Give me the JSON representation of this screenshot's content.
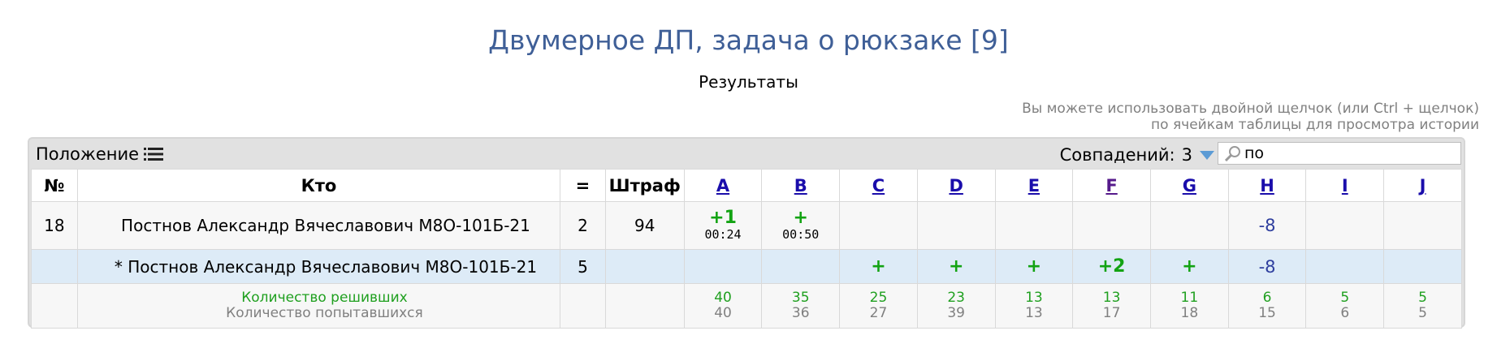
{
  "header": {
    "title": "Двумерное ДП, задача о рюкзаке [9]",
    "subtitle": "Результаты",
    "hint_line1": "Вы можете использовать двойной щелчок (или Ctrl + щелчок)",
    "hint_line2": "по ячейкам таблицы для просмотра истории"
  },
  "toolbar": {
    "position_label": "Положение",
    "matches_label": "Совпадений:",
    "matches_count": "3",
    "search_value": "по",
    "icons": [
      "list-icon",
      "triangle-down-icon",
      "magnifier-icon"
    ]
  },
  "table": {
    "headers": {
      "num": "№",
      "who": "Кто",
      "solved": "=",
      "penalty": "Штраф",
      "problems": [
        "A",
        "B",
        "C",
        "D",
        "E",
        "F",
        "G",
        "H",
        "I",
        "J"
      ]
    },
    "rows": [
      {
        "num": "18",
        "who": "Постнов Александр Вячеславович М8О-101Б-21",
        "solved": "2",
        "penalty": "94",
        "cells": [
          {
            "result": "+1",
            "time": "00:24"
          },
          {
            "result": "+",
            "time": "00:50"
          },
          {
            "result": "",
            "time": ""
          },
          {
            "result": "",
            "time": ""
          },
          {
            "result": "",
            "time": ""
          },
          {
            "result": "",
            "time": ""
          },
          {
            "result": "",
            "time": ""
          },
          {
            "result": "-8",
            "time": ""
          },
          {
            "result": "",
            "time": ""
          },
          {
            "result": "",
            "time": ""
          }
        ]
      },
      {
        "num": "",
        "who": "* Постнов Александр Вячеславович М8О-101Б-21",
        "solved": "5",
        "penalty": "",
        "cells": [
          {
            "result": "",
            "time": ""
          },
          {
            "result": "",
            "time": ""
          },
          {
            "result": "+",
            "time": ""
          },
          {
            "result": "+",
            "time": ""
          },
          {
            "result": "+",
            "time": ""
          },
          {
            "result": "+2",
            "time": ""
          },
          {
            "result": "+",
            "time": ""
          },
          {
            "result": "-8",
            "time": ""
          },
          {
            "result": "",
            "time": ""
          },
          {
            "result": "",
            "time": ""
          }
        ]
      }
    ],
    "stats": {
      "solved_label": "Количество решивших",
      "tried_label": "Количество попытавшихся",
      "solved": [
        "40",
        "35",
        "25",
        "23",
        "13",
        "13",
        "11",
        "6",
        "5",
        "5"
      ],
      "tried": [
        "40",
        "36",
        "27",
        "39",
        "13",
        "17",
        "18",
        "15",
        "6",
        "5"
      ]
    }
  },
  "colors": {
    "title": "#3f5f97",
    "accepted": "#13a313",
    "rejected": "#2e3e9e",
    "highlight_row": "#ddebf7",
    "link": "#1a0dab",
    "visited_link": "#551a8b"
  }
}
